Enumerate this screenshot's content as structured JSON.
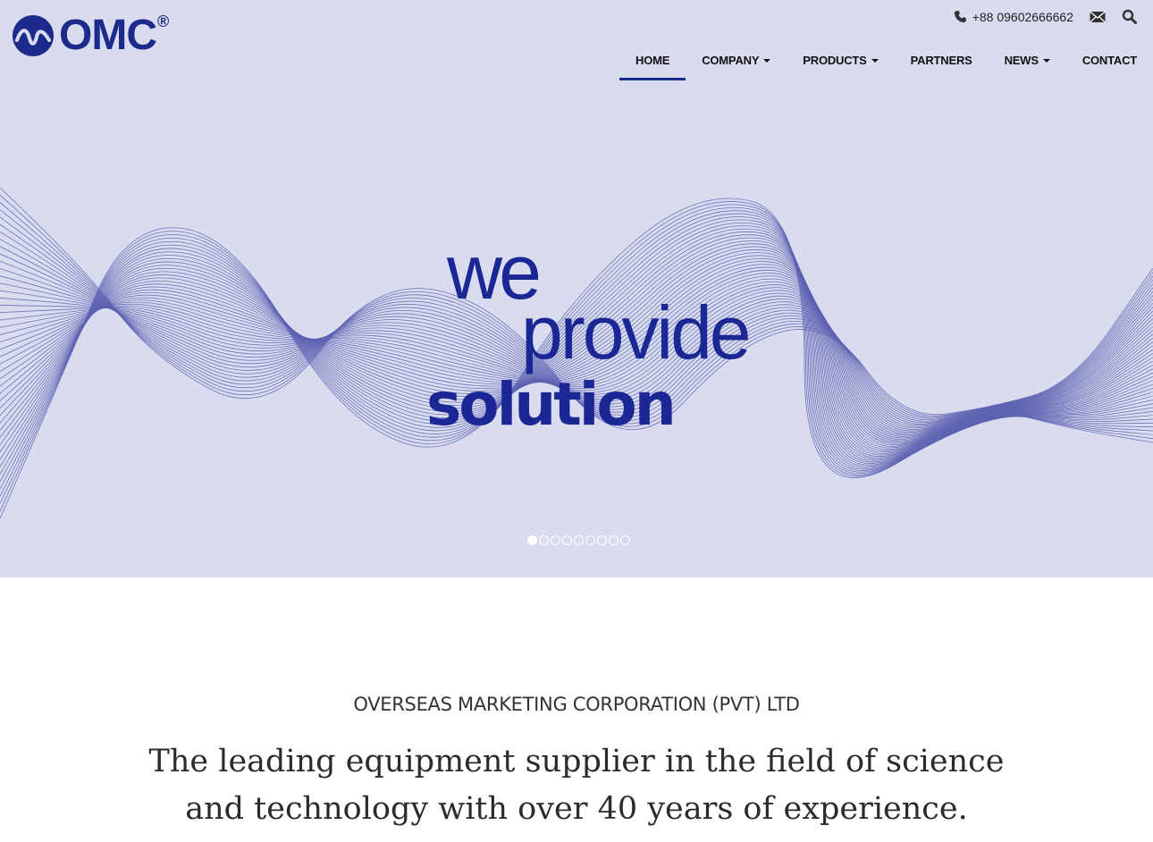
{
  "brand": {
    "name": "OMC",
    "reg": "®",
    "color": "#1c2a8c"
  },
  "topbar": {
    "phone": "+88 09602666662",
    "icons": [
      "phone-icon",
      "mail-icon",
      "search-icon"
    ]
  },
  "nav": {
    "items": [
      {
        "label": "HOME",
        "active": true,
        "dropdown": false
      },
      {
        "label": "COMPANY",
        "active": false,
        "dropdown": true
      },
      {
        "label": "PRODUCTS",
        "active": false,
        "dropdown": true
      },
      {
        "label": "PARTNERS",
        "active": false,
        "dropdown": false
      },
      {
        "label": "NEWS",
        "active": false,
        "dropdown": true
      },
      {
        "label": "CONTACT",
        "active": false,
        "dropdown": false
      }
    ]
  },
  "hero": {
    "line1": "we",
    "line2": "provide",
    "line3": "solution",
    "background": "#d9dcee",
    "wave_color": "#5b5fb0",
    "slides_total": 9,
    "active_slide": 1
  },
  "intro": {
    "company": "OVERSEAS MARKETING CORPORATION (PVT) LTD",
    "tagline_line1": "The leading equipment supplier in the field of science",
    "tagline_line2": "and technology with over 40 years of experience."
  }
}
